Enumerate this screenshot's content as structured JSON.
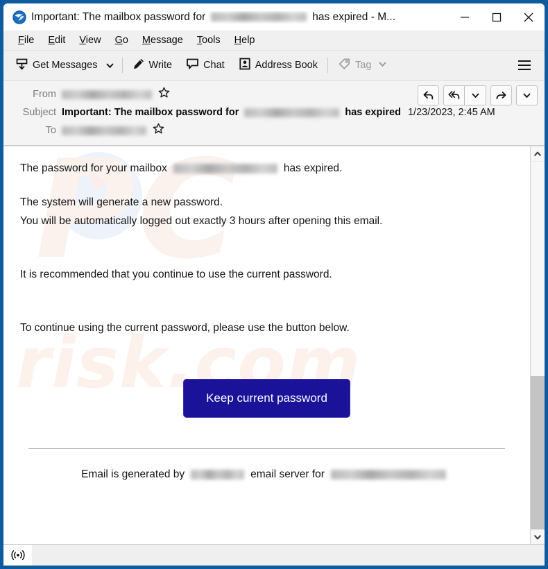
{
  "window": {
    "title_prefix": "Important: The mailbox password for",
    "title_suffix": "has expired - M...",
    "app_icon": "thunderbird-icon",
    "border_color": "#0e5c9e",
    "controls": {
      "minimize": "minimize-icon",
      "maximize": "maximize-icon",
      "close": "close-icon"
    }
  },
  "menubar": {
    "items": [
      {
        "accesskey": "F",
        "rest": "ile"
      },
      {
        "accesskey": "E",
        "rest": "dit"
      },
      {
        "accesskey": "V",
        "rest": "iew"
      },
      {
        "accesskey": "G",
        "rest": "o"
      },
      {
        "accesskey": "M",
        "rest": "essage"
      },
      {
        "accesskey": "T",
        "rest": "ools"
      },
      {
        "accesskey": "H",
        "rest": "elp"
      }
    ]
  },
  "toolbar": {
    "get_messages_label": "Get Messages",
    "write_label": "Write",
    "chat_label": "Chat",
    "address_book_label": "Address Book",
    "tag_label": "Tag",
    "tag_disabled": true,
    "menu_icon": "hamburger-menu-icon"
  },
  "message_header": {
    "from_label": "From",
    "subject_label": "Subject",
    "to_label": "To",
    "subject_prefix": "Important: The mailbox password for",
    "subject_suffix": "has expired",
    "date": "1/23/2023, 2:45 AM",
    "from_redacted": true,
    "to_redacted": true,
    "actions": {
      "reply": "reply-icon",
      "reply_all": "reply-all-icon",
      "reply_more": "chevron-down-icon",
      "forward": "forward-icon",
      "forward_more": "chevron-down-icon"
    }
  },
  "body": {
    "line1_prefix": "The password for your mailbox",
    "line1_suffix": "has expired.",
    "line2": "The system will generate a new password.",
    "line3": "You will be automatically logged out exactly 3 hours after opening this email.",
    "line4": "It is recommended that you continue to use the current password.",
    "line5": "To continue using the current password, please use the button below.",
    "button_label": "Keep current password",
    "button_color": "#1a1299",
    "footer_prefix": "Email is generated by",
    "footer_middle": "email server for",
    "watermark_top": "PC",
    "watermark_bottom": "risk.com"
  },
  "statusbar": {
    "icon": "broadcast-icon"
  }
}
